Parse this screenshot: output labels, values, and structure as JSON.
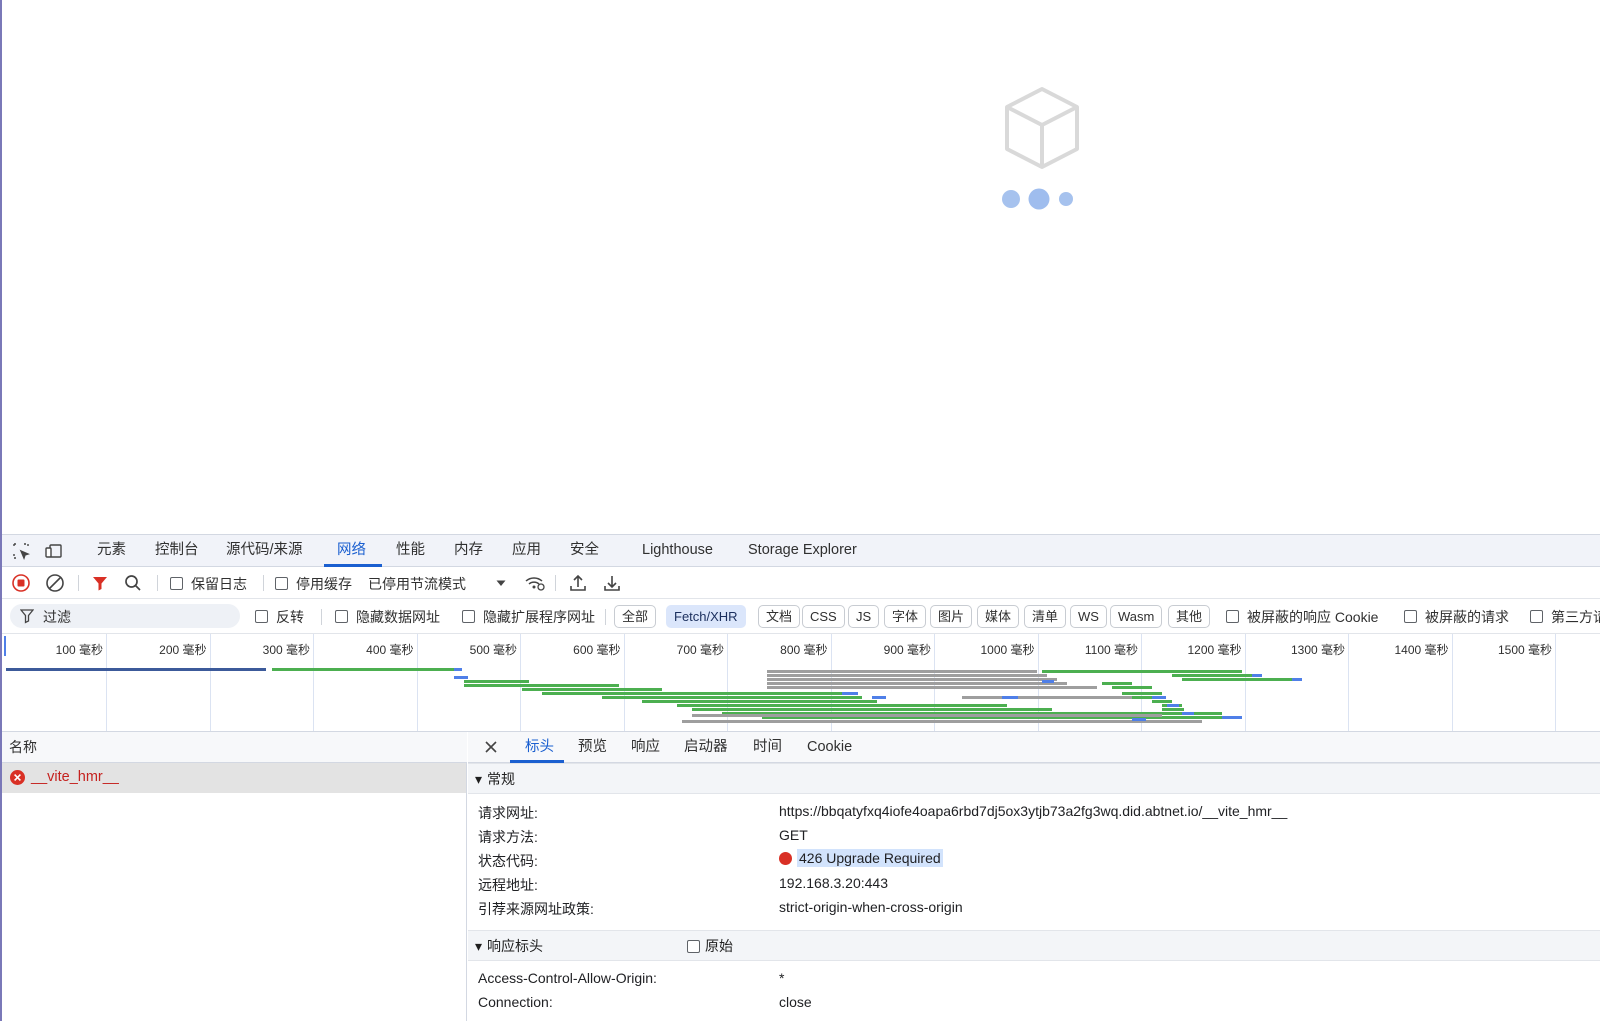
{
  "devtools": {
    "tabs": [
      "元素",
      "控制台",
      "源代码/来源",
      "网络",
      "性能",
      "内存",
      "应用",
      "安全",
      "Lighthouse",
      "Storage Explorer"
    ],
    "active_tab": "网络"
  },
  "toolbar": {
    "preserve_log": "保留日志",
    "disable_cache": "停用缓存",
    "throttling": "已停用节流模式"
  },
  "filter": {
    "placeholder": "过滤",
    "invert": "反转",
    "hide_data_urls": "隐藏数据网址",
    "hide_extension_urls": "隐藏扩展程序网址",
    "types": [
      "全部",
      "Fetch/XHR",
      "文档",
      "CSS",
      "JS",
      "字体",
      "图片",
      "媒体",
      "清单",
      "WS",
      "Wasm",
      "其他"
    ],
    "selected_type": "Fetch/XHR",
    "blocked_response_cookies": "被屏蔽的响应 Cookie",
    "blocked_requests": "被屏蔽的请求",
    "third_party": "第三方请"
  },
  "overview": {
    "ticks": [
      "100 毫秒",
      "200 毫秒",
      "300 毫秒",
      "400 毫秒",
      "500 毫秒",
      "600 毫秒",
      "700 毫秒",
      "800 毫秒",
      "900 毫秒",
      "1000 毫秒",
      "1100 毫秒",
      "1200 毫秒",
      "1300 毫秒",
      "1400 毫秒",
      "1500 毫秒"
    ],
    "colors": {
      "waiting": "#4caf50",
      "download": "#4f7fe8",
      "queued": "#9e9e9e",
      "connection": "#3c5a9a"
    }
  },
  "requests": {
    "column_name": "名称",
    "rows": [
      {
        "name": "__vite_hmr__",
        "status": "error"
      }
    ]
  },
  "details": {
    "tabs": [
      "标头",
      "预览",
      "响应",
      "启动器",
      "时间",
      "Cookie"
    ],
    "active_tab": "标头",
    "general": {
      "title": "常规",
      "rows": [
        {
          "key": "请求网址:",
          "value": "https://bbqatyfxq4iofe4oapa6rbd7dj5ox3ytjb73a2fg3wq.did.abtnet.io/__vite_hmr__"
        },
        {
          "key": "请求方法:",
          "value": "GET"
        },
        {
          "key": "状态代码:",
          "value": "426 Upgrade Required"
        },
        {
          "key": "远程地址:",
          "value": "192.168.3.20:443"
        },
        {
          "key": "引荐来源网址政策:",
          "value": "strict-origin-when-cross-origin"
        }
      ]
    },
    "response_headers": {
      "title": "响应标头",
      "raw_label": "原始",
      "rows": [
        {
          "key": "Access-Control-Allow-Origin:",
          "value": "*"
        },
        {
          "key": "Connection:",
          "value": "close"
        }
      ]
    }
  },
  "colors": {
    "accent": "#1a5fd0",
    "error": "#d93025",
    "loader": "#a6c2ee"
  }
}
